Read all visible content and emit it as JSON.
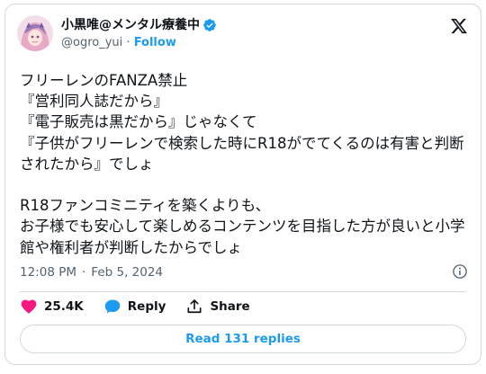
{
  "author": {
    "display_name": "小黒唯@メンタル療養中",
    "handle": "@ogro_yui",
    "separator": "·",
    "follow_label": "Follow"
  },
  "tweet": {
    "text": "フリーレンのFANZA禁止\n『営利同人誌だから』\n『電子販売は黒だから』じゃなくて\n『子供がフリーレンで検索した時にR18がでてくるのは有害と判断されたから』でしょ\n\nR18ファンコミニティを築くよりも、\nお子様でも安心して楽しめるコンテンツを目指した方が良いと小学館や権利者が判断したからでしょ",
    "time": "12:08 PM",
    "date_separator": "·",
    "date": "Feb 5, 2024"
  },
  "actions": {
    "likes": "25.4K",
    "reply_label": "Reply",
    "share_label": "Share"
  },
  "read_replies_label": "Read 131 replies",
  "colors": {
    "accent": "#1d9bf0",
    "like": "#f91880",
    "secondary_text": "#536471",
    "border": "#cfd9de"
  },
  "icons": {
    "verified": "verified-badge-icon",
    "logo": "x-logo-icon",
    "info": "info-icon",
    "like": "heart-icon",
    "reply": "reply-bubble-icon",
    "share": "share-icon"
  }
}
